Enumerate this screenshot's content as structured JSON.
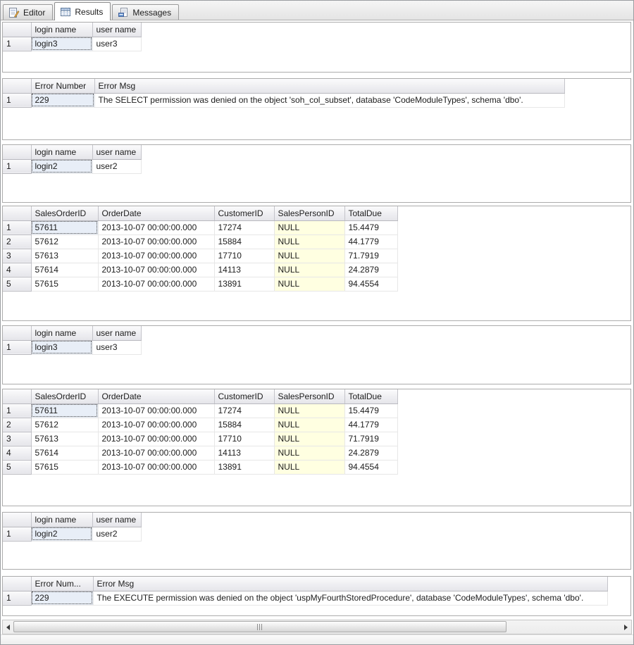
{
  "tabs": [
    {
      "label": "Editor",
      "icon": "editor-icon",
      "active": false
    },
    {
      "label": "Results",
      "icon": "results-grid-icon",
      "active": true
    },
    {
      "label": "Messages",
      "icon": "messages-icon",
      "active": false
    }
  ],
  "grids": [
    {
      "kind": "login",
      "columns": [
        "login name",
        "user name"
      ],
      "rows": [
        [
          "login3",
          "user3"
        ]
      ]
    },
    {
      "kind": "error",
      "columns": [
        "Error Number",
        "Error Msg"
      ],
      "rows": [
        [
          "229",
          "The SELECT permission was denied on the object 'soh_col_subset', database 'CodeModuleTypes', schema 'dbo'."
        ]
      ]
    },
    {
      "kind": "login",
      "columns": [
        "login name",
        "user name"
      ],
      "rows": [
        [
          "login2",
          "user2"
        ]
      ]
    },
    {
      "kind": "sales",
      "columns": [
        "SalesOrderID",
        "OrderDate",
        "CustomerID",
        "SalesPersonID",
        "TotalDue"
      ],
      "rows": [
        [
          "57611",
          "2013-10-07 00:00:00.000",
          "17274",
          "NULL",
          "15.4479"
        ],
        [
          "57612",
          "2013-10-07 00:00:00.000",
          "15884",
          "NULL",
          "44.1779"
        ],
        [
          "57613",
          "2013-10-07 00:00:00.000",
          "17710",
          "NULL",
          "71.7919"
        ],
        [
          "57614",
          "2013-10-07 00:00:00.000",
          "14113",
          "NULL",
          "24.2879"
        ],
        [
          "57615",
          "2013-10-07 00:00:00.000",
          "13891",
          "NULL",
          "94.4554"
        ]
      ]
    },
    {
      "kind": "login",
      "columns": [
        "login name",
        "user name"
      ],
      "rows": [
        [
          "login3",
          "user3"
        ]
      ]
    },
    {
      "kind": "sales",
      "columns": [
        "SalesOrderID",
        "OrderDate",
        "CustomerID",
        "SalesPersonID",
        "TotalDue"
      ],
      "rows": [
        [
          "57611",
          "2013-10-07 00:00:00.000",
          "17274",
          "NULL",
          "15.4479"
        ],
        [
          "57612",
          "2013-10-07 00:00:00.000",
          "15884",
          "NULL",
          "44.1779"
        ],
        [
          "57613",
          "2013-10-07 00:00:00.000",
          "17710",
          "NULL",
          "71.7919"
        ],
        [
          "57614",
          "2013-10-07 00:00:00.000",
          "14113",
          "NULL",
          "24.2879"
        ],
        [
          "57615",
          "2013-10-07 00:00:00.000",
          "13891",
          "NULL",
          "94.4554"
        ]
      ]
    },
    {
      "kind": "login",
      "columns": [
        "login name",
        "user name"
      ],
      "rows": [
        [
          "login2",
          "user2"
        ]
      ]
    },
    {
      "kind": "error",
      "columns": [
        "Error Num...",
        "Error Msg"
      ],
      "rows": [
        [
          "229",
          "The EXECUTE permission was denied on the object 'uspMyFourthStoredProcedure', database 'CodeModuleTypes', schema 'dbo'."
        ]
      ]
    }
  ],
  "colors": {
    "selection_bg": "#E8EEF7",
    "null_cell_bg": "#FFFFE1",
    "header_from": "#FBFBFC",
    "header_to": "#E5E5EA",
    "grid_line": "#E7E7E7",
    "panel_border": "#ACACAC"
  }
}
